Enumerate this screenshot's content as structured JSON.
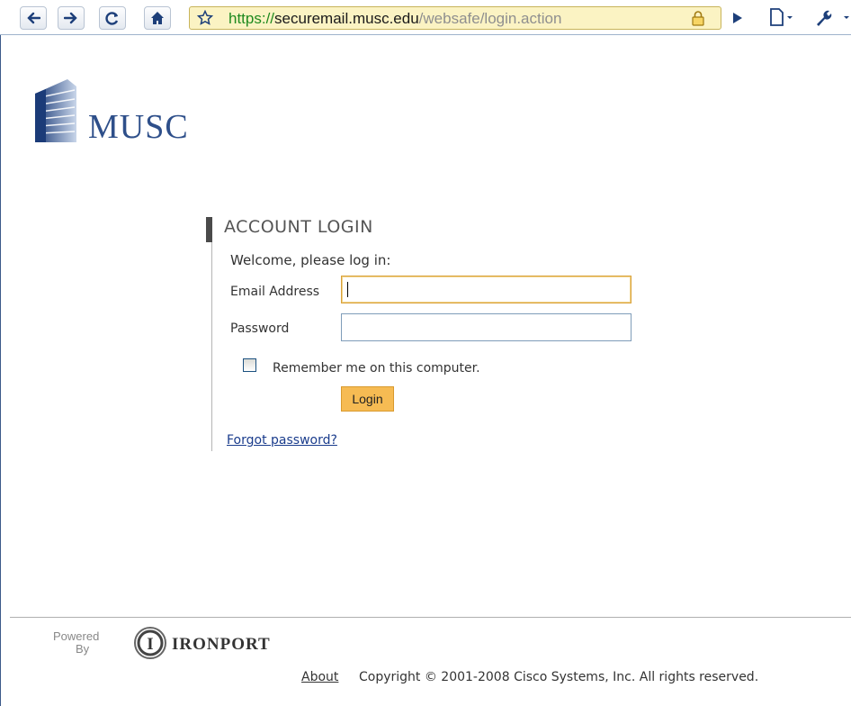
{
  "browser": {
    "url": {
      "scheme": "https://",
      "host": "securemail.musc.edu",
      "path": "/websafe/login.action"
    }
  },
  "icons": {
    "back": "back-arrow-icon",
    "forward": "forward-arrow-icon",
    "reload": "reload-icon",
    "home": "home-icon",
    "bookmark": "star-icon",
    "lock": "lock-icon",
    "page": "page-icon",
    "tools": "wrench-icon"
  },
  "colors": {
    "accent": "#f6bb53",
    "brand": "#2e4f8a",
    "url_bar": "#fbf3c3",
    "link": "#1a3c8c"
  },
  "header": {
    "logo_text": "MUSC"
  },
  "login": {
    "title": "ACCOUNT LOGIN",
    "welcome": "Welcome, please log in:",
    "email_label": "Email Address",
    "email_value": "",
    "password_label": "Password",
    "password_value": "",
    "remember_label": "Remember me on this computer.",
    "remember_checked": false,
    "login_button": "Login",
    "forgot_link": "Forgot password?"
  },
  "footer": {
    "powered": "Powered",
    "by": "By",
    "brand": "IRONPORT",
    "about_link": "About",
    "copyright": "Copyright © 2001-2008 Cisco Systems, Inc. All rights reserved."
  }
}
